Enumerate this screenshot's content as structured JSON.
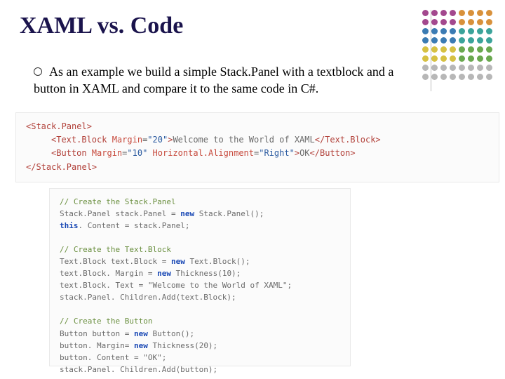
{
  "title": "XAML vs. Code",
  "bullet": "As an example we build a simple Stack.Panel with a textblock and a button in XAML and compare it to the same code in C#.",
  "xaml": {
    "l1a": "<Stack.Panel>",
    "l2_tag_open": "<Text.Block ",
    "l2_attr": "Margin",
    "l2_eq": "=",
    "l2_val": "\"20\"",
    "l2_gt": ">",
    "l2_text": "Welcome to the World of XAML",
    "l2_close": "</Text.Block>",
    "l3_tag_open": "<Button ",
    "l3_attr1": "Margin",
    "l3_eq1": "=",
    "l3_val1": "\"10\" ",
    "l3_attr2": "Horizontal.Alignment",
    "l3_eq2": "=",
    "l3_val2": "\"Right\"",
    "l3_gt": ">",
    "l3_text": "OK",
    "l3_close": "</Button>",
    "l4": "</Stack.Panel>"
  },
  "cs": {
    "c1": "// Create the Stack.Panel",
    "l2a": "Stack.Panel  stack.Panel ",
    "l2eq": "= ",
    "l2new": "new",
    "l2b": " Stack.Panel();",
    "l3a": "this",
    "l3b": ". Content ",
    "l3eq": "=",
    "l3c": " stack.Panel;",
    "c4": "// Create the Text.Block",
    "l5a": "Text.Block  text.Block ",
    "l5eq": "= ",
    "l5new": "new",
    "l5b": " Text.Block();",
    "l6a": "text.Block. Margin ",
    "l6eq": "= ",
    "l6new": "new",
    "l6b": " Thickness(10);",
    "l7a": "text.Block. Text ",
    "l7eq": "=",
    "l7b": " \"Welcome to the World of XAML\";",
    "l8": "stack.Panel. Children.Add(text.Block);",
    "c9": "// Create the Button",
    "l10a": "Button button ",
    "l10eq": "= ",
    "l10new": "new",
    "l10b": " Button();",
    "l11a": "button. Margin",
    "l11eq": "= ",
    "l11new": "new",
    "l11b": " Thickness(20);",
    "l12a": "button. Content ",
    "l12eq": "=",
    "l12b": " \"OK\";",
    "l13": "stack.Panel. Children.Add(button);"
  }
}
